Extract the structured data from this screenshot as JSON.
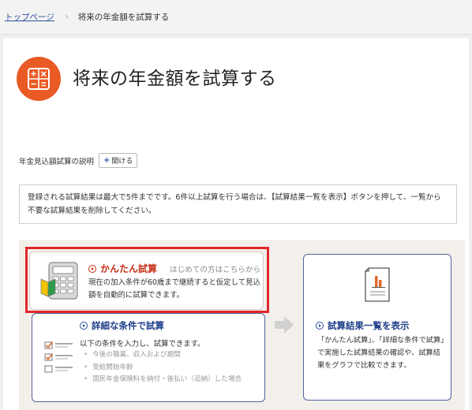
{
  "breadcrumb": {
    "home": "トップページ",
    "current": "将来の年金額を試算する"
  },
  "page_title": "将来の年金額を試算する",
  "explain": {
    "label": "年金見込額試算の説明",
    "open_button": "開ける"
  },
  "notice": {
    "text": "登録される試算結果は最大で5件までです。6件以上試算を行う場合は、【試算結果一覧を表示】ボタンを押して、一覧から不要な試算結果を削除してください。"
  },
  "simple": {
    "title": "かんたん試算",
    "subtitle": "はじめての方はこちらから",
    "description": "現在の加入条件が60歳まで継続すると仮定して見込額を自動的に試算できます。"
  },
  "detail": {
    "title": "詳細な条件で試算",
    "description": "以下の条件を入力し、試算できます。",
    "conditions": [
      "今後の職業、収入および期間",
      "受給開始年齢",
      "国民年金保険料を納付・後払い（追納）した場合"
    ]
  },
  "result": {
    "title": "試算結果一覧を表示",
    "description": "「かんたん試算」、「詳細な条件で試算」で実施した試算結果の確認や、試算結果をグラフで比較できます。"
  },
  "icons": {
    "title": "calculator-icon",
    "simple": "calculator-beginner-icon",
    "detail": "checklist-icon",
    "result": "report-chart-icon",
    "arrow": "arrow-right-icon"
  },
  "colors": {
    "accent_orange": "#ea5a24",
    "highlight_red": "#e2262b",
    "title_red": "#c8321c",
    "navy": "#1f3f8a",
    "link_blue": "#2a4f9e"
  }
}
